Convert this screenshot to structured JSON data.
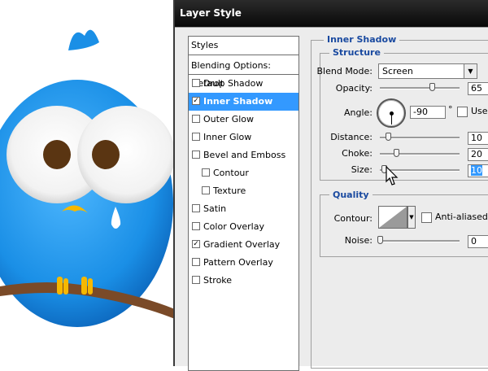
{
  "dialog": {
    "title": "Layer Style"
  },
  "styles_list": {
    "header": "Styles",
    "blending": "Blending Options: Default",
    "items": [
      {
        "label": "Drop Shadow",
        "checked": false,
        "selected": false,
        "sub": false
      },
      {
        "label": "Inner Shadow",
        "checked": true,
        "selected": true,
        "sub": false
      },
      {
        "label": "Outer Glow",
        "checked": false,
        "selected": false,
        "sub": false
      },
      {
        "label": "Inner Glow",
        "checked": false,
        "selected": false,
        "sub": false
      },
      {
        "label": "Bevel and Emboss",
        "checked": false,
        "selected": false,
        "sub": false
      },
      {
        "label": "Contour",
        "checked": false,
        "selected": false,
        "sub": true
      },
      {
        "label": "Texture",
        "checked": false,
        "selected": false,
        "sub": true
      },
      {
        "label": "Satin",
        "checked": false,
        "selected": false,
        "sub": false
      },
      {
        "label": "Color Overlay",
        "checked": false,
        "selected": false,
        "sub": false
      },
      {
        "label": "Gradient Overlay",
        "checked": true,
        "selected": false,
        "sub": false
      },
      {
        "label": "Pattern Overlay",
        "checked": false,
        "selected": false,
        "sub": false
      },
      {
        "label": "Stroke",
        "checked": false,
        "selected": false,
        "sub": false
      }
    ]
  },
  "inner_shadow": {
    "section_title": "Inner Shadow",
    "structure": {
      "title": "Structure",
      "blend_mode_label": "Blend Mode:",
      "blend_mode": "Screen",
      "opacity_label": "Opacity:",
      "opacity": "65",
      "opacity_level": 0.65,
      "angle_label": "Angle:",
      "angle": "-90",
      "degree": "°",
      "use_global_label": "Use G",
      "distance_label": "Distance:",
      "distance": "10",
      "distance_level": 0.1,
      "choke_label": "Choke:",
      "choke": "20",
      "choke_level": 0.2,
      "size_label": "Size:",
      "size": "10",
      "size_level": 0.05
    },
    "quality": {
      "title": "Quality",
      "contour_label": "Contour:",
      "anti_aliased_label": "Anti-aliased",
      "noise_label": "Noise:",
      "noise": "0",
      "noise_level": 0
    }
  },
  "icons": {
    "cursor": "arrow-cursor-icon",
    "dropdown": "triangle-down-icon"
  },
  "colors": {
    "bird_blue": "#1a8fe6",
    "selection": "#3399ff",
    "section_title": "#1a4aa0"
  }
}
